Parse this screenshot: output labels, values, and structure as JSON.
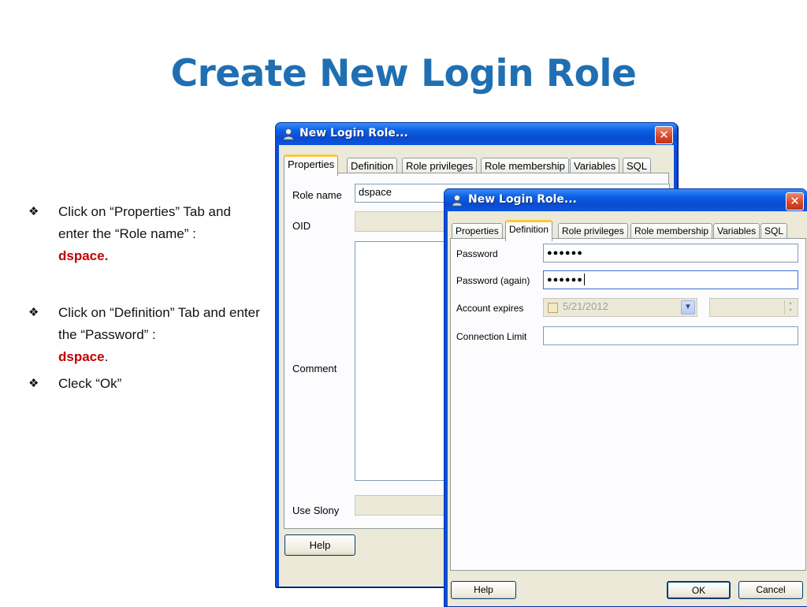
{
  "slide": {
    "title": "Create New Login Role",
    "bullets": [
      {
        "mark": "❖",
        "text": "Click on “Properties” Tab and enter the “Role name” :",
        "highlight": "dspace.",
        "after": ""
      },
      {
        "mark": "❖",
        "text": "Click on “Definition” Tab and enter the “Password” :",
        "highlight": "dspace",
        "after": "."
      },
      {
        "mark": "❖",
        "text": "Cleck “Ok”",
        "highlight": "",
        "after": ""
      }
    ]
  },
  "back_dialog": {
    "title": "New Login Role...",
    "tabs": [
      "Properties",
      "Definition",
      "Role privileges",
      "Role membership",
      "Variables",
      "SQL"
    ],
    "active_tab": "Properties",
    "labels": {
      "role_name": "Role name",
      "oid": "OID",
      "comment": "Comment",
      "use_slony": "Use Slony"
    },
    "role_name_value": "dspace",
    "help_button": "Help"
  },
  "front_dialog": {
    "title": "New Login Role...",
    "tabs": [
      "Properties",
      "Definition",
      "Role privileges",
      "Role membership",
      "Variables",
      "SQL"
    ],
    "active_tab": "Definition",
    "labels": {
      "password": "Password",
      "password_again": "Password (again)",
      "account_expires": "Account expires",
      "connection_limit": "Connection Limit"
    },
    "password_value": "●●●●●●",
    "password_again_value": "●●●●●●",
    "account_expires_value": "5/21/2012",
    "buttons": {
      "help": "Help",
      "ok": "OK",
      "cancel": "Cancel"
    }
  },
  "colors": {
    "title": "#1f6fb2",
    "highlight": "#c00000",
    "xp_blue": "#0a58e0",
    "tab_accent": "#ffc83c"
  }
}
